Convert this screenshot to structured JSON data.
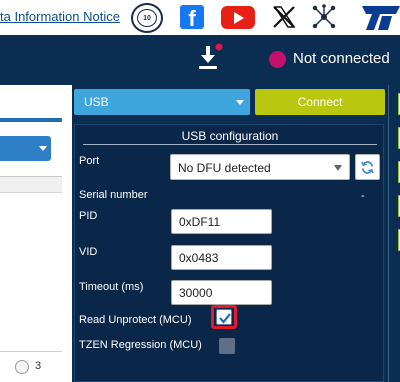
{
  "topbar": {
    "notice_text": "ta Information Notice",
    "badge_text": "10",
    "icons": [
      "anniversary-badge-icon",
      "facebook-icon",
      "youtube-icon",
      "x-icon",
      "network-icon",
      "st-logo"
    ]
  },
  "header": {
    "connection_status": "Not connected",
    "status_color": "#c4126c"
  },
  "left_panel": {
    "page_number": "3"
  },
  "interface_select": {
    "value": "USB"
  },
  "connect_button": {
    "label": "Connect"
  },
  "usb_config": {
    "title": "USB configuration",
    "port_label": "Port",
    "port_value": "No DFU detected",
    "serial_number_label": "Serial number",
    "serial_number_value": "-",
    "pid_label": "PID",
    "pid_value": "0xDF11",
    "vid_label": "VID",
    "vid_value": "0x0483",
    "timeout_label": "Timeout (ms)",
    "timeout_value": "30000",
    "read_unprotect_label": "Read Unprotect (MCU)",
    "read_unprotect_checked": true,
    "tzen_label": "TZEN Regression (MCU)",
    "tzen_checked": false
  },
  "colors": {
    "navy": "#0c2d52",
    "usb_blue": "#3ea6dc",
    "connect_green": "#b9c70f",
    "highlight_red": "#e21a2c"
  }
}
